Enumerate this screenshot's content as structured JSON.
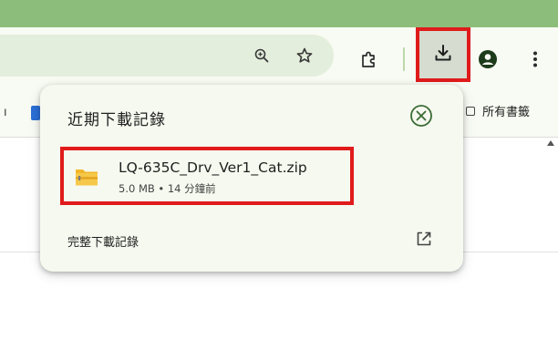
{
  "toolbar": {
    "icons": [
      "zoom-icon",
      "star-icon",
      "extensions-icon",
      "download-icon",
      "profile-icon",
      "menu-icon"
    ]
  },
  "bookmarks_bar": {
    "left_fragment": "ı",
    "right_label": "所有書籤"
  },
  "downloads_popup": {
    "title": "近期下載記錄",
    "items": [
      {
        "file_name": "LQ-635C_Drv_Ver1_Cat.zip",
        "meta": "5.0 MB • 14 分鐘前"
      }
    ],
    "full_history_label": "完整下載記錄"
  },
  "colors": {
    "accent": "#e01b1b",
    "titlebar": "#8dbd7a",
    "toolbar": "#f8fbf3",
    "omnibox": "#e4eedc",
    "popup": "#f6f9ef",
    "close_icon": "#3a6b35"
  }
}
